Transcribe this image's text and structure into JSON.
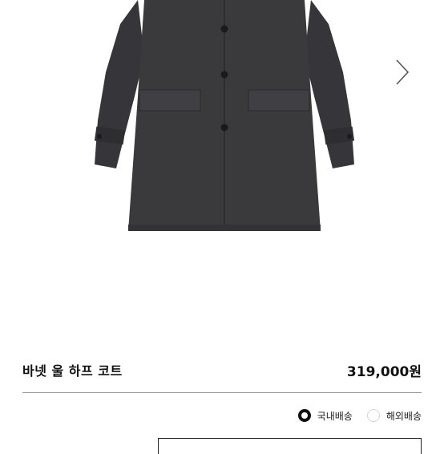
{
  "product": {
    "name": "바넷 울 하프 코트",
    "price": "319,000원"
  },
  "gallery": {
    "next_icon": "chevron-right-icon",
    "coat_color": "#3a3a3c"
  },
  "shipping": {
    "options": [
      {
        "label": "국내배송",
        "selected": true
      },
      {
        "label": "해외배송",
        "selected": false
      }
    ]
  }
}
